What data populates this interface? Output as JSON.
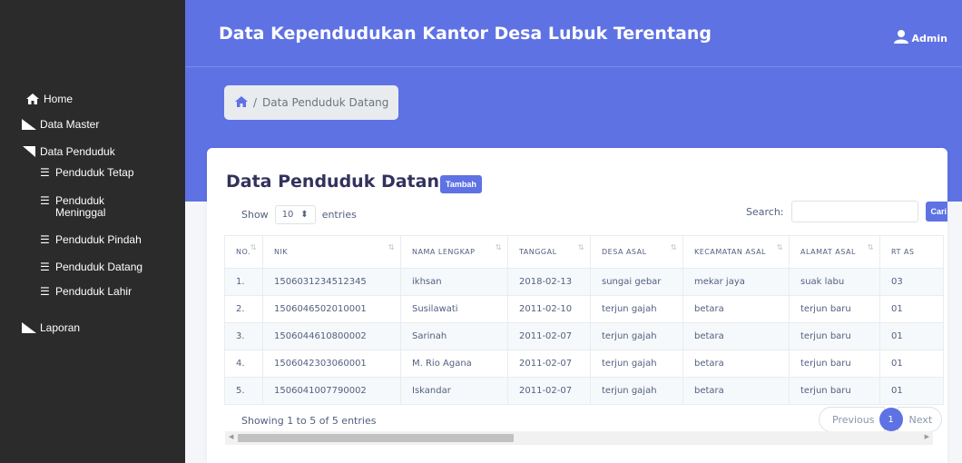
{
  "sidebar": {
    "home": "Home",
    "data_master": "Data Master",
    "data_penduduk": "Data Penduduk",
    "sub": [
      "Penduduk Tetap",
      "Penduduk Meninggal",
      "Penduduk Pindah",
      "Penduduk Datang",
      "Penduduk Lahir"
    ],
    "laporan": "Laporan"
  },
  "header": {
    "title": "Data Kependudukan Kantor Desa Lubuk Terentang",
    "user": "Admin"
  },
  "breadcrumb": {
    "current": "Data Penduduk Datang"
  },
  "card": {
    "title": "Data Penduduk Datang",
    "add_button": "Tambah",
    "show_label": "Show",
    "entries_label": "entries",
    "page_size": "10",
    "search_label": "Search:",
    "search_value": "",
    "search_button": "Cari"
  },
  "table": {
    "columns": [
      "NO.",
      "NIK",
      "NAMA LENGKAP",
      "TANGGAL",
      "DESA ASAL",
      "KECAMATAN ASAL",
      "ALAMAT ASAL",
      "RT AS"
    ],
    "rows": [
      [
        "1.",
        "1506031234512345",
        "ikhsan",
        "2018-02-13",
        "sungai gebar",
        "mekar jaya",
        "suak labu",
        "03"
      ],
      [
        "2.",
        "1506046502010001",
        "Susilawati",
        "2011-02-10",
        "terjun gajah",
        "betara",
        "terjun baru",
        "01"
      ],
      [
        "3.",
        "1506044610800002",
        "Sarinah",
        "2011-02-07",
        "terjun gajah",
        "betara",
        "terjun baru",
        "01"
      ],
      [
        "4.",
        "1506042303060001",
        "M. Rio Agana",
        "2011-02-07",
        "terjun gajah",
        "betara",
        "terjun baru",
        "01"
      ],
      [
        "5.",
        "1506041007790002",
        "Iskandar",
        "2011-02-07",
        "terjun gajah",
        "betara",
        "terjun baru",
        "01"
      ]
    ]
  },
  "footer": {
    "info": "Showing 1 to 5 of 5 entries",
    "prev": "Previous",
    "page": "1",
    "next": "Next"
  }
}
